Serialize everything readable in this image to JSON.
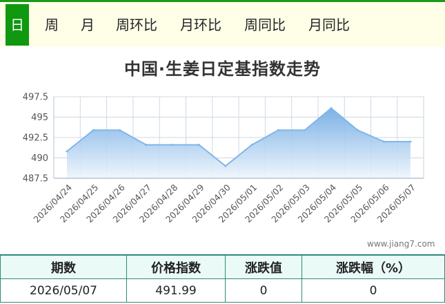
{
  "tabs": [
    {
      "label": "日",
      "active": true
    },
    {
      "label": "周",
      "active": false
    },
    {
      "label": "月",
      "active": false
    },
    {
      "label": "周环比",
      "active": false
    },
    {
      "label": "月环比",
      "active": false
    },
    {
      "label": "周同比",
      "active": false
    },
    {
      "label": "月同比",
      "active": false
    }
  ],
  "chart_data": {
    "type": "area",
    "title": "中国·生姜日定基指数走势",
    "xlabel": "",
    "ylabel": "",
    "categories": [
      "2026/04/24",
      "2026/04/25",
      "2026/04/26",
      "2026/04/27",
      "2026/04/28",
      "2026/04/29",
      "2026/04/30",
      "2026/05/01",
      "2026/05/02",
      "2026/05/03",
      "2026/05/04",
      "2026/05/05",
      "2026/05/06",
      "2026/05/07"
    ],
    "values": [
      490.8,
      493.4,
      493.4,
      491.6,
      491.6,
      491.6,
      489.0,
      491.6,
      493.4,
      493.4,
      496.1,
      493.4,
      491.99,
      491.99
    ],
    "ylim": [
      487.5,
      497.5
    ],
    "yticks": [
      "497.5",
      "495",
      "492.5",
      "490",
      "487.5"
    ],
    "grid": true,
    "colors": {
      "line": "#7fb6ea",
      "fill_top": "#6fa9e3",
      "fill_bottom": "#eef5fc",
      "grid": "#cfd8e3"
    }
  },
  "watermark": "www.jiang7.com",
  "table": {
    "headers": [
      "期数",
      "价格指数",
      "涨跌值",
      "涨跌幅（%）"
    ],
    "row": [
      "2026/05/07",
      "491.99",
      "0",
      "0"
    ]
  }
}
